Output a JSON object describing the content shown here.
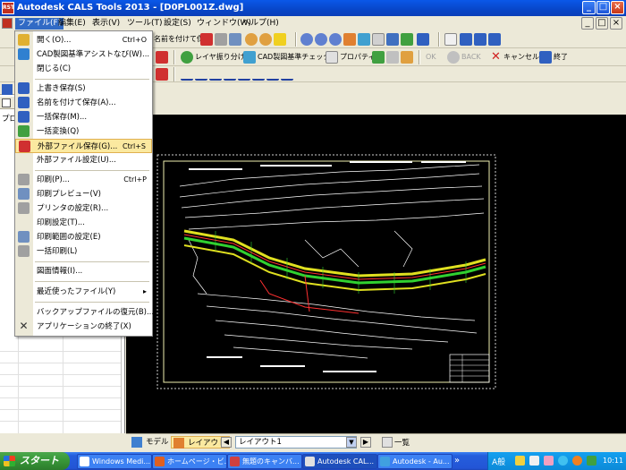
{
  "window": {
    "title": "Autodesk CALS Tools 2013 - [D0PL001Z.dwg]",
    "app_icon_text": "RST",
    "buttons": [
      "_",
      "□",
      "×"
    ]
  },
  "menubar": {
    "items": [
      "ファイル(F)",
      "編集(E)",
      "表示(V)",
      "ツール(T)",
      "設定(S)",
      "ウィンドウ(W)",
      "ヘルプ(H)"
    ],
    "mdi_buttons": [
      "_",
      "□",
      "×"
    ]
  },
  "toolbar": {
    "save_as_partial": "名前を付けて保存",
    "layer_split": "レイヤ振り分け",
    "cad_check": "CAD製図基準チェック",
    "properties": "プロパティ",
    "ok": "OK",
    "back": "BACK",
    "cancel": "キャンセル",
    "finish": "終了"
  },
  "file_menu": {
    "items": [
      {
        "label": "開く(O)...",
        "shortcut": "Ctrl+O"
      },
      {
        "label": "CAD製図基準アシストなび(W)...",
        "shortcut": ""
      },
      {
        "label": "閉じる(C)",
        "shortcut": ""
      },
      {
        "label": "上書き保存(S)",
        "shortcut": ""
      },
      {
        "label": "名前を付けて保存(A)...",
        "shortcut": ""
      },
      {
        "label": "一括保存(M)...",
        "shortcut": ""
      },
      {
        "label": "一括変換(Q)",
        "shortcut": ""
      },
      {
        "label": "外部ファイル保存(G)...",
        "shortcut": "Ctrl+S"
      },
      {
        "label": "外部ファイル設定(U)...",
        "shortcut": ""
      },
      {
        "label": "印刷(P)...",
        "shortcut": "Ctrl+P"
      },
      {
        "label": "印刷プレビュー(V)",
        "shortcut": ""
      },
      {
        "label": "プリンタの設定(R)...",
        "shortcut": ""
      },
      {
        "label": "印刷設定(T)...",
        "shortcut": ""
      },
      {
        "label": "印刷範囲の設定(E)",
        "shortcut": ""
      },
      {
        "label": "一括印刷(L)",
        "shortcut": ""
      },
      {
        "label": "図面情報(I)...",
        "shortcut": ""
      },
      {
        "label": "最近使ったファイル(Y)",
        "shortcut": "▸"
      },
      {
        "label": "バックアップファイルの復元(B)...",
        "shortcut": ""
      },
      {
        "label": "アプリケーションの終了(X)",
        "shortcut": ""
      }
    ]
  },
  "left_panel": {
    "tab_label": "プロ"
  },
  "layout_tabs": {
    "model": "モデル",
    "layout": "レイアウト",
    "layout_select": "レイアウト1",
    "list_button": "一覧"
  },
  "taskbar": {
    "start": "スタート",
    "items": [
      "Windows Medi...",
      "ホームページ・ビ...",
      "無題のキャンバ...",
      "Autodesk CAL...",
      "Autodesk - Au..."
    ],
    "clock": "10:11",
    "ime": "A般"
  },
  "colors": {
    "titlebar": "#0846c8",
    "highlight": "#fbe9a0",
    "canvas": "#000000",
    "taskbar": "#245edc",
    "start": "#3a9a3a"
  }
}
